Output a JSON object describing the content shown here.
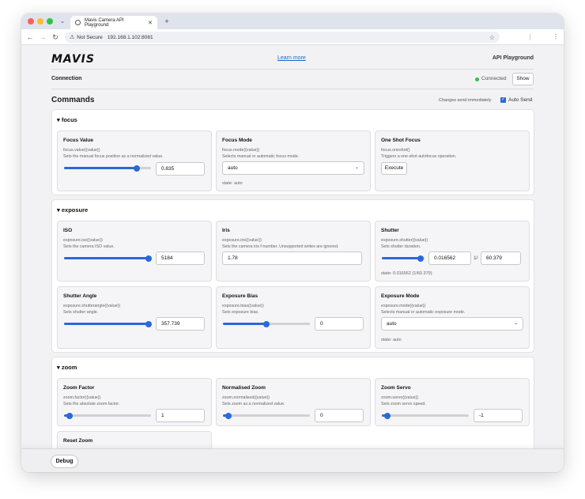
{
  "browser": {
    "tab_title": "Mavis Camera API Playground",
    "not_secure": "Not Secure",
    "url": "192.168.1.102:8081",
    "traffic_colors": [
      "#ff5f57",
      "#febc2e",
      "#28c840"
    ]
  },
  "header": {
    "logo": "MAVIS",
    "learn_more": "Learn more",
    "app_title": "API Playground"
  },
  "connection": {
    "title": "Connection",
    "status": "Connected",
    "show_label": "Show"
  },
  "commands": {
    "title": "Commands",
    "changes_note": "Changes send immediately",
    "auto_send_label": "Auto Send",
    "auto_send_checked": true
  },
  "sections": {
    "focus": {
      "title": "▾ focus",
      "value": {
        "title": "Focus Value",
        "sig": "focus.value({value})",
        "desc": "Sets the manual focus position as a normalized value.",
        "input": "0.835",
        "slider_fraction": 0.835
      },
      "mode": {
        "title": "Focus Mode",
        "sig": "focus.mode({value})",
        "desc": "Selects manual or automatic focus mode.",
        "selected": "auto",
        "state": "state: auto"
      },
      "oneshot": {
        "title": "One Shot Focus",
        "sig": "focus.oneshot()",
        "desc": "Triggers a one-shot autofocus operation.",
        "button": "Execute"
      }
    },
    "exposure": {
      "title": "▾ exposure",
      "iso": {
        "title": "ISO",
        "sig": "exposure.iso({value})",
        "desc": "Sets the camera ISO value.",
        "input": "5184",
        "slider_fraction": 0.97
      },
      "iris": {
        "title": "Iris",
        "sig": "exposure.iris({value})",
        "desc": "Sets the camera iris f-number. Unsupported writes are ignored.",
        "input": "1.78"
      },
      "shutter": {
        "title": "Shutter",
        "sig": "exposure.shutter({value})",
        "desc": "Sets shutter duration.",
        "input": "0.016562",
        "separator": "1/",
        "denominator": "60.379",
        "state": "state: 0.016562 (1/60.379)",
        "slider_fraction": 0.9
      },
      "angle": {
        "title": "Shutter Angle",
        "sig": "exposure.shutterangle({value})",
        "desc": "Sets shutter angle.",
        "input": "357.739",
        "slider_fraction": 0.97
      },
      "bias": {
        "title": "Exposure Bias",
        "sig": "exposure.bias({value})",
        "desc": "Sets exposure bias.",
        "input": "0",
        "slider_fraction": 0.5
      },
      "mode": {
        "title": "Exposure Mode",
        "sig": "exposure.mode({value})",
        "desc": "Selects manual or automatic exposure mode.",
        "selected": "auto",
        "state": "state: auto"
      }
    },
    "zoom": {
      "title": "▾ zoom",
      "factor": {
        "title": "Zoom Factor",
        "sig": "zoom.factor({value})",
        "desc": "Sets the absolute zoom factor.",
        "input": "1",
        "slider_fraction": 0.06
      },
      "normalised": {
        "title": "Normalised Zoom",
        "sig": "zoom.normalised({value})",
        "desc": "Sets zoom as a normalized value.",
        "input": "0",
        "slider_fraction": 0.06
      },
      "servo": {
        "title": "Zoom Servo",
        "sig": "zoom.servo({value})",
        "desc": "Sets zoom servo speed.",
        "input": "-1",
        "slider_fraction": 0.06
      },
      "reset": {
        "title": "Reset Zoom"
      }
    }
  },
  "footer": {
    "debug_label": "Debug"
  },
  "colors": {
    "accent": "#2a6ad8",
    "connected": "#2fbf55",
    "link": "#1a66d2"
  }
}
